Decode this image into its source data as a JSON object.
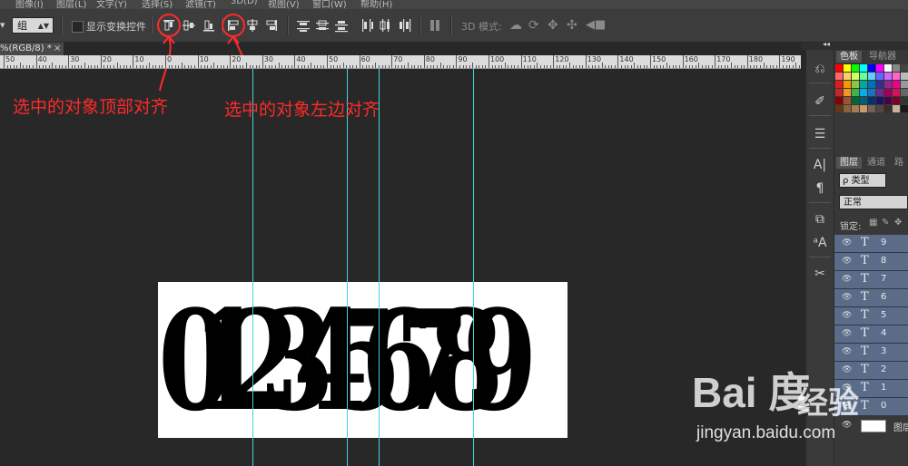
{
  "menubar": {
    "items": [
      "图像(I)",
      "图层(L)",
      "文字(Y)",
      "选择(S)",
      "滤镜(T)",
      "3D(D)",
      "视图(V)",
      "窗口(W)",
      "帮助(H)"
    ]
  },
  "options_bar": {
    "auto_select_value": "组",
    "show_transform_label": "显示变换控件",
    "show_transform_checked": false,
    "mode3d_label": "3D 模式:",
    "align_buttons": [
      "align-top-edges-icon",
      "align-vertical-centers-icon",
      "align-bottom-edges-icon",
      "align-left-edges-icon",
      "align-horizontal-centers-icon",
      "align-right-edges-icon"
    ],
    "distribute_buttons": [
      "distribute-top-icon",
      "distribute-vcenter-icon",
      "distribute-bottom-icon",
      "distribute-left-icon",
      "distribute-hcenter-icon",
      "distribute-right-icon",
      "auto-align-icon"
    ],
    "mode3d_buttons": [
      "rotate-3d-icon",
      "roll-3d-icon",
      "drag-3d-icon",
      "slide-3d-icon",
      "scale-3d-icon"
    ]
  },
  "document": {
    "tab_label": "%(RGB/8) *",
    "close_glyph": "×",
    "image_text": "0123456789"
  },
  "ruler": {
    "labels": [
      "50",
      "40",
      "30",
      "20",
      "10",
      "0",
      "10",
      "20",
      "30",
      "40",
      "50",
      "60",
      "70",
      "80",
      "90",
      "100",
      "110",
      "120",
      "130",
      "140",
      "150",
      "160",
      "170",
      "180",
      "190"
    ]
  },
  "annotations": {
    "top_align": "选中的对象顶部对齐",
    "left_align": "选中的对象左边对齐",
    "color": "#ff2a2a"
  },
  "guides": {
    "color": "#3fd6e0",
    "count": 4
  },
  "panels": {
    "collapse_glyph": "◂◂",
    "color_tabs": [
      "色板",
      "导航器"
    ],
    "layer_tabs": [
      "图层",
      "通道",
      "路"
    ],
    "kind_filter": "ρ 类型",
    "blend_mode": "正常",
    "lock_label": "锁定:",
    "layers": [
      {
        "type": "T",
        "name": "9"
      },
      {
        "type": "T",
        "name": "8"
      },
      {
        "type": "T",
        "name": "7"
      },
      {
        "type": "T",
        "name": "6"
      },
      {
        "type": "T",
        "name": "5"
      },
      {
        "type": "T",
        "name": "4"
      },
      {
        "type": "T",
        "name": "3"
      },
      {
        "type": "T",
        "name": "2"
      },
      {
        "type": "T",
        "name": "1"
      },
      {
        "type": "T",
        "name": "0"
      }
    ],
    "background_layer_name": "图层",
    "eye_glyph": "👁",
    "layer_row_color": "#5a6c88"
  },
  "dock_icons": [
    "history-icon",
    "brush-preset-icon",
    "properties-icon",
    "character-icon",
    "paragraph-icon",
    "clone-source-icon",
    "char-style-icon",
    "tools-preset-icon"
  ],
  "watermark": {
    "logo": "Bai 度",
    "jingyan": "经验",
    "url": "jingyan.baidu.com"
  },
  "swatches": [
    "#ff0000",
    "#ffff00",
    "#00ff00",
    "#00ffff",
    "#0000ff",
    "#ff00ff",
    "#ffffff",
    "#888888",
    "#444444",
    "#ff6666",
    "#ffcc66",
    "#ccff66",
    "#66ff99",
    "#66ccff",
    "#6666ff",
    "#cc66ff",
    "#ff66cc",
    "#bbbbbb",
    "#e21a1a",
    "#f09a00",
    "#8cc63f",
    "#00a99d",
    "#0072bc",
    "#2e3192",
    "#92278f",
    "#ec008c",
    "#999999",
    "#c1272d",
    "#f7931e",
    "#39b54a",
    "#00aeef",
    "#1b75bc",
    "#662d91",
    "#9e005d",
    "#d4145a",
    "#666666",
    "#8b0000",
    "#a0522d",
    "#006837",
    "#005e75",
    "#003471",
    "#1b1464",
    "#4b0049",
    "#7a0026",
    "#333333",
    "#603813",
    "#8c6239",
    "#a67c52",
    "#c69c6d",
    "#736357",
    "#534741",
    "#362f2d",
    "#c7b299",
    "#1a1a1a"
  ]
}
